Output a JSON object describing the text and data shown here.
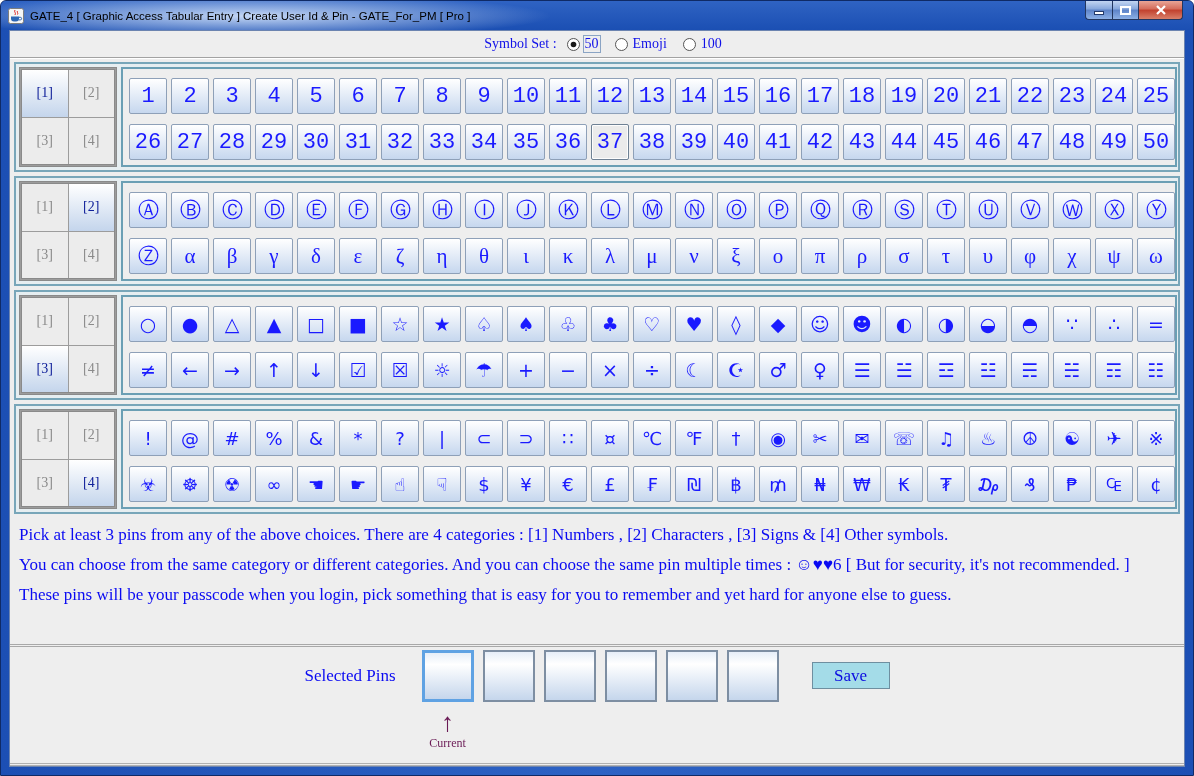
{
  "window": {
    "title": "GATE_4 [ Graphic Access Tabular Entry ] Create User Id & Pin - GATE_For_PM [ Pro ]"
  },
  "symbol_set": {
    "label": "Symbol Set :",
    "options": [
      {
        "label": "50",
        "selected": true,
        "focused": true
      },
      {
        "label": "Emoji",
        "selected": false,
        "focused": false
      },
      {
        "label": "100",
        "selected": false,
        "focused": false
      }
    ]
  },
  "panels": [
    {
      "categories": [
        {
          "label": "[1]",
          "selected": true
        },
        {
          "label": "[2]",
          "selected": false
        },
        {
          "label": "[3]",
          "selected": false
        },
        {
          "label": "[4]",
          "selected": false
        }
      ],
      "rows": [
        [
          {
            "label": "1",
            "highlighted": false
          },
          {
            "label": "2",
            "highlighted": false
          },
          {
            "label": "3",
            "highlighted": false
          },
          {
            "label": "4",
            "highlighted": false
          },
          {
            "label": "5",
            "highlighted": false
          },
          {
            "label": "6",
            "highlighted": false
          },
          {
            "label": "7",
            "highlighted": false
          },
          {
            "label": "8",
            "highlighted": false
          },
          {
            "label": "9",
            "highlighted": false
          },
          {
            "label": "10",
            "highlighted": false
          },
          {
            "label": "11",
            "highlighted": false
          },
          {
            "label": "12",
            "highlighted": false
          },
          {
            "label": "13",
            "highlighted": false
          },
          {
            "label": "14",
            "highlighted": false
          },
          {
            "label": "15",
            "highlighted": false
          },
          {
            "label": "16",
            "highlighted": false
          },
          {
            "label": "17",
            "highlighted": false
          },
          {
            "label": "18",
            "highlighted": false
          },
          {
            "label": "19",
            "highlighted": false
          },
          {
            "label": "20",
            "highlighted": false
          },
          {
            "label": "21",
            "highlighted": false
          },
          {
            "label": "22",
            "highlighted": false
          },
          {
            "label": "23",
            "highlighted": false
          },
          {
            "label": "24",
            "highlighted": false
          },
          {
            "label": "25",
            "highlighted": false
          }
        ],
        [
          {
            "label": "26",
            "highlighted": false
          },
          {
            "label": "27",
            "highlighted": false
          },
          {
            "label": "28",
            "highlighted": false
          },
          {
            "label": "29",
            "highlighted": false
          },
          {
            "label": "30",
            "highlighted": false
          },
          {
            "label": "31",
            "highlighted": false
          },
          {
            "label": "32",
            "highlighted": false
          },
          {
            "label": "33",
            "highlighted": false
          },
          {
            "label": "34",
            "highlighted": false
          },
          {
            "label": "35",
            "highlighted": false
          },
          {
            "label": "36",
            "highlighted": false
          },
          {
            "label": "37",
            "highlighted": true
          },
          {
            "label": "38",
            "highlighted": false
          },
          {
            "label": "39",
            "highlighted": false
          },
          {
            "label": "40",
            "highlighted": false
          },
          {
            "label": "41",
            "highlighted": false
          },
          {
            "label": "42",
            "highlighted": false
          },
          {
            "label": "43",
            "highlighted": false
          },
          {
            "label": "44",
            "highlighted": false
          },
          {
            "label": "45",
            "highlighted": false
          },
          {
            "label": "46",
            "highlighted": false
          },
          {
            "label": "47",
            "highlighted": false
          },
          {
            "label": "48",
            "highlighted": false
          },
          {
            "label": "49",
            "highlighted": false
          },
          {
            "label": "50",
            "highlighted": false
          }
        ]
      ]
    },
    {
      "categories": [
        {
          "label": "[1]",
          "selected": false
        },
        {
          "label": "[2]",
          "selected": true
        },
        {
          "label": "[3]",
          "selected": false
        },
        {
          "label": "[4]",
          "selected": false
        }
      ],
      "rows": [
        [
          {
            "label": "Ⓐ",
            "highlighted": false
          },
          {
            "label": "Ⓑ",
            "highlighted": false
          },
          {
            "label": "Ⓒ",
            "highlighted": false
          },
          {
            "label": "Ⓓ",
            "highlighted": false
          },
          {
            "label": "Ⓔ",
            "highlighted": false
          },
          {
            "label": "Ⓕ",
            "highlighted": false
          },
          {
            "label": "Ⓖ",
            "highlighted": false
          },
          {
            "label": "Ⓗ",
            "highlighted": false
          },
          {
            "label": "Ⓘ",
            "highlighted": false
          },
          {
            "label": "Ⓙ",
            "highlighted": false
          },
          {
            "label": "Ⓚ",
            "highlighted": false
          },
          {
            "label": "Ⓛ",
            "highlighted": false
          },
          {
            "label": "Ⓜ",
            "highlighted": false
          },
          {
            "label": "Ⓝ",
            "highlighted": false
          },
          {
            "label": "Ⓞ",
            "highlighted": false
          },
          {
            "label": "Ⓟ",
            "highlighted": false
          },
          {
            "label": "Ⓠ",
            "highlighted": false
          },
          {
            "label": "Ⓡ",
            "highlighted": false
          },
          {
            "label": "Ⓢ",
            "highlighted": false
          },
          {
            "label": "Ⓣ",
            "highlighted": false
          },
          {
            "label": "Ⓤ",
            "highlighted": false
          },
          {
            "label": "Ⓥ",
            "highlighted": false
          },
          {
            "label": "Ⓦ",
            "highlighted": false
          },
          {
            "label": "Ⓧ",
            "highlighted": false
          },
          {
            "label": "Ⓨ",
            "highlighted": false
          }
        ],
        [
          {
            "label": "Ⓩ",
            "highlighted": false
          },
          {
            "label": "α",
            "highlighted": false
          },
          {
            "label": "β",
            "highlighted": false
          },
          {
            "label": "γ",
            "highlighted": false
          },
          {
            "label": "δ",
            "highlighted": false
          },
          {
            "label": "ε",
            "highlighted": false
          },
          {
            "label": "ζ",
            "highlighted": false
          },
          {
            "label": "η",
            "highlighted": false
          },
          {
            "label": "θ",
            "highlighted": false
          },
          {
            "label": "ι",
            "highlighted": false
          },
          {
            "label": "κ",
            "highlighted": false
          },
          {
            "label": "λ",
            "highlighted": false
          },
          {
            "label": "μ",
            "highlighted": false
          },
          {
            "label": "ν",
            "highlighted": false
          },
          {
            "label": "ξ",
            "highlighted": false
          },
          {
            "label": "ο",
            "highlighted": false
          },
          {
            "label": "π",
            "highlighted": false
          },
          {
            "label": "ρ",
            "highlighted": false
          },
          {
            "label": "σ",
            "highlighted": false
          },
          {
            "label": "τ",
            "highlighted": false
          },
          {
            "label": "υ",
            "highlighted": false
          },
          {
            "label": "φ",
            "highlighted": false
          },
          {
            "label": "χ",
            "highlighted": false
          },
          {
            "label": "ψ",
            "highlighted": false
          },
          {
            "label": "ω",
            "highlighted": false
          }
        ]
      ]
    },
    {
      "categories": [
        {
          "label": "[1]",
          "selected": false
        },
        {
          "label": "[2]",
          "selected": false
        },
        {
          "label": "[3]",
          "selected": true
        },
        {
          "label": "[4]",
          "selected": false
        }
      ],
      "rows": [
        [
          {
            "label": "○",
            "highlighted": false
          },
          {
            "label": "●",
            "highlighted": false
          },
          {
            "label": "△",
            "highlighted": false
          },
          {
            "label": "▲",
            "highlighted": false
          },
          {
            "label": "□",
            "highlighted": false
          },
          {
            "label": "■",
            "highlighted": false
          },
          {
            "label": "☆",
            "highlighted": false
          },
          {
            "label": "★",
            "highlighted": false
          },
          {
            "label": "♤",
            "highlighted": false
          },
          {
            "label": "♠",
            "highlighted": false
          },
          {
            "label": "♧",
            "highlighted": false
          },
          {
            "label": "♣",
            "highlighted": false
          },
          {
            "label": "♡",
            "highlighted": false
          },
          {
            "label": "♥",
            "highlighted": false
          },
          {
            "label": "◊",
            "highlighted": false
          },
          {
            "label": "◆",
            "highlighted": false
          },
          {
            "label": "☺",
            "highlighted": false
          },
          {
            "label": "☻",
            "highlighted": false
          },
          {
            "label": "◐",
            "highlighted": false
          },
          {
            "label": "◑",
            "highlighted": false
          },
          {
            "label": "◒",
            "highlighted": false
          },
          {
            "label": "◓",
            "highlighted": false
          },
          {
            "label": "∵",
            "highlighted": false
          },
          {
            "label": "∴",
            "highlighted": false
          },
          {
            "label": "=",
            "highlighted": false
          }
        ],
        [
          {
            "label": "≠",
            "highlighted": false
          },
          {
            "label": "←",
            "highlighted": false
          },
          {
            "label": "→",
            "highlighted": false
          },
          {
            "label": "↑",
            "highlighted": false
          },
          {
            "label": "↓",
            "highlighted": false
          },
          {
            "label": "☑",
            "highlighted": false
          },
          {
            "label": "☒",
            "highlighted": false
          },
          {
            "label": "☼",
            "highlighted": false
          },
          {
            "label": "☂",
            "highlighted": false
          },
          {
            "label": "+",
            "highlighted": false
          },
          {
            "label": "−",
            "highlighted": false
          },
          {
            "label": "×",
            "highlighted": false
          },
          {
            "label": "÷",
            "highlighted": false
          },
          {
            "label": "☾",
            "highlighted": false
          },
          {
            "label": "☪",
            "highlighted": false
          },
          {
            "label": "♂",
            "highlighted": false
          },
          {
            "label": "♀",
            "highlighted": false
          },
          {
            "label": "☰",
            "highlighted": false
          },
          {
            "label": "☱",
            "highlighted": false
          },
          {
            "label": "☲",
            "highlighted": false
          },
          {
            "label": "☳",
            "highlighted": false
          },
          {
            "label": "☴",
            "highlighted": false
          },
          {
            "label": "☵",
            "highlighted": false
          },
          {
            "label": "☶",
            "highlighted": false
          },
          {
            "label": "☷",
            "highlighted": false
          }
        ]
      ]
    },
    {
      "categories": [
        {
          "label": "[1]",
          "selected": false
        },
        {
          "label": "[2]",
          "selected": false
        },
        {
          "label": "[3]",
          "selected": false
        },
        {
          "label": "[4]",
          "selected": true
        }
      ],
      "rows": [
        [
          {
            "label": "!",
            "highlighted": false
          },
          {
            "label": "@",
            "highlighted": false
          },
          {
            "label": "#",
            "highlighted": false
          },
          {
            "label": "%",
            "highlighted": false
          },
          {
            "label": "&",
            "highlighted": false
          },
          {
            "label": "*",
            "highlighted": false
          },
          {
            "label": "?",
            "highlighted": false
          },
          {
            "label": "|",
            "highlighted": false
          },
          {
            "label": "⊂",
            "highlighted": false
          },
          {
            "label": "⊃",
            "highlighted": false
          },
          {
            "label": "∷",
            "highlighted": false
          },
          {
            "label": "¤",
            "highlighted": false
          },
          {
            "label": "℃",
            "highlighted": false
          },
          {
            "label": "℉",
            "highlighted": false
          },
          {
            "label": "†",
            "highlighted": false
          },
          {
            "label": "◉",
            "highlighted": false
          },
          {
            "label": "✂",
            "highlighted": false
          },
          {
            "label": "✉",
            "highlighted": false
          },
          {
            "label": "☏",
            "highlighted": false
          },
          {
            "label": "♫",
            "highlighted": false
          },
          {
            "label": "♨",
            "highlighted": false
          },
          {
            "label": "☮",
            "highlighted": false
          },
          {
            "label": "☯",
            "highlighted": false
          },
          {
            "label": "✈",
            "highlighted": false
          },
          {
            "label": "※",
            "highlighted": false
          }
        ],
        [
          {
            "label": "☣",
            "highlighted": false
          },
          {
            "label": "☸",
            "highlighted": false
          },
          {
            "label": "☢",
            "highlighted": false
          },
          {
            "label": "∞",
            "highlighted": false
          },
          {
            "label": "☚",
            "highlighted": false
          },
          {
            "label": "☛",
            "highlighted": false
          },
          {
            "label": "☝",
            "highlighted": false
          },
          {
            "label": "☟",
            "highlighted": false
          },
          {
            "label": "$",
            "highlighted": false
          },
          {
            "label": "¥",
            "highlighted": false
          },
          {
            "label": "€",
            "highlighted": false
          },
          {
            "label": "£",
            "highlighted": false
          },
          {
            "label": "₣",
            "highlighted": false
          },
          {
            "label": "₪",
            "highlighted": false
          },
          {
            "label": "฿",
            "highlighted": false
          },
          {
            "label": "₥",
            "highlighted": false
          },
          {
            "label": "₦",
            "highlighted": false
          },
          {
            "label": "₩",
            "highlighted": false
          },
          {
            "label": "₭",
            "highlighted": false
          },
          {
            "label": "₮",
            "highlighted": false
          },
          {
            "label": "₯",
            "highlighted": false
          },
          {
            "label": "₰",
            "highlighted": false
          },
          {
            "label": "₱",
            "highlighted": false
          },
          {
            "label": "₠",
            "highlighted": false
          },
          {
            "label": "¢",
            "highlighted": false
          }
        ]
      ]
    }
  ],
  "instructions": [
    "Pick at least 3 pins from any of the above choices. There are 4 categories : [1] Numbers , [2] Characters , [3] Signs & [4] Other symbols.",
    "You can choose from the same category or different categories. And you can choose the same pin multiple times : ☺♥♥6 [ But for security, it's not recommended. ]",
    "These pins will be your passcode when you login, pick something that is easy for you to remember and yet hard for anyone else to guess."
  ],
  "pins": {
    "label": "Selected Pins",
    "slots": [
      {
        "current": true
      },
      {
        "current": false
      },
      {
        "current": false
      },
      {
        "current": false
      },
      {
        "current": false
      },
      {
        "current": false
      }
    ],
    "arrow": "↑",
    "current_label": "Current"
  },
  "save_button": {
    "label": "Save"
  }
}
